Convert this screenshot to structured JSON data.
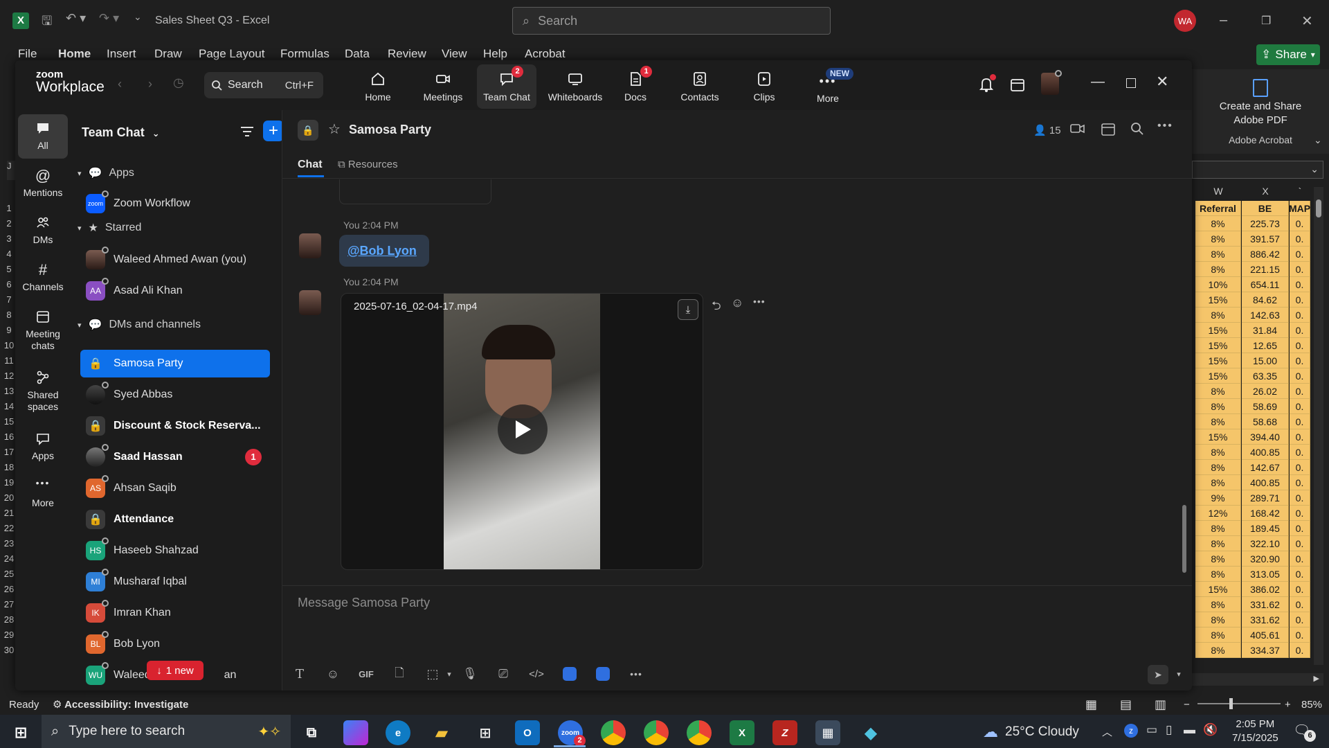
{
  "excel": {
    "title": "Sales Sheet Q3  -  Excel",
    "search_placeholder": "Search",
    "user_initials": "WA",
    "menu": [
      "File",
      "Home",
      "Insert",
      "Draw",
      "Page Layout",
      "Formulas",
      "Data",
      "Review",
      "View",
      "Help",
      "Acrobat"
    ],
    "share_label": "Share",
    "acrobat_btn": "Create and Share Adobe PDF",
    "acrobat_group": "Adobe Acrobat",
    "columns": [
      "W",
      "X"
    ],
    "col_headers": [
      "Referral",
      "BE",
      "MAP"
    ],
    "rows": [
      [
        "8%",
        "225.73",
        "0."
      ],
      [
        "8%",
        "391.57",
        "0."
      ],
      [
        "8%",
        "886.42",
        "0."
      ],
      [
        "8%",
        "221.15",
        "0."
      ],
      [
        "10%",
        "654.11",
        "0."
      ],
      [
        "15%",
        "84.62",
        "0."
      ],
      [
        "8%",
        "142.63",
        "0."
      ],
      [
        "15%",
        "31.84",
        "0."
      ],
      [
        "15%",
        "12.65",
        "0."
      ],
      [
        "15%",
        "15.00",
        "0."
      ],
      [
        "15%",
        "63.35",
        "0."
      ],
      [
        "8%",
        "26.02",
        "0."
      ],
      [
        "8%",
        "58.69",
        "0."
      ],
      [
        "8%",
        "58.68",
        "0."
      ],
      [
        "15%",
        "394.40",
        "0."
      ],
      [
        "8%",
        "400.85",
        "0."
      ],
      [
        "8%",
        "142.67",
        "0."
      ],
      [
        "8%",
        "400.85",
        "0."
      ],
      [
        "9%",
        "289.71",
        "0."
      ],
      [
        "12%",
        "168.42",
        "0."
      ],
      [
        "8%",
        "189.45",
        "0."
      ],
      [
        "8%",
        "322.10",
        "0."
      ],
      [
        "8%",
        "320.90",
        "0."
      ],
      [
        "8%",
        "313.05",
        "0."
      ],
      [
        "15%",
        "386.02",
        "0."
      ],
      [
        "8%",
        "331.62",
        "0."
      ],
      [
        "8%",
        "331.62",
        "0."
      ],
      [
        "8%",
        "405.61",
        "0."
      ],
      [
        "8%",
        "334.37",
        "0."
      ]
    ],
    "row_numbers": [
      "1",
      "2",
      "3",
      "4",
      "5",
      "6",
      "7",
      "8",
      "9",
      "10",
      "11",
      "12",
      "13",
      "14",
      "15",
      "16",
      "17",
      "18",
      "19",
      "20",
      "21",
      "22",
      "23",
      "24",
      "25",
      "26",
      "27",
      "28",
      "29",
      "30"
    ],
    "status_ready": "Ready",
    "status_accessibility": "Accessibility: Investigate",
    "zoom_level": "85%",
    "cell_fill": "#f5c56a"
  },
  "zoom": {
    "brand_line1": "zoom",
    "brand_line2": "Workplace",
    "search_label": "Search",
    "search_shortcut": "Ctrl+F",
    "nav": [
      {
        "label": "Home",
        "badge": ""
      },
      {
        "label": "Meetings",
        "badge": ""
      },
      {
        "label": "Team Chat",
        "badge": "2"
      },
      {
        "label": "Whiteboards",
        "badge": ""
      },
      {
        "label": "Docs",
        "badge": "1"
      },
      {
        "label": "Contacts",
        "badge": ""
      },
      {
        "label": "Clips",
        "badge": ""
      },
      {
        "label": "More",
        "badge": "NEW"
      }
    ],
    "rail": [
      "All",
      "Mentions",
      "DMs",
      "Channels",
      "Meeting chats",
      "Shared spaces",
      "Apps",
      "More"
    ],
    "sidebar": {
      "title": "Team Chat",
      "sections": {
        "apps": "Apps",
        "starred": "Starred",
        "dms": "DMs and channels"
      },
      "apps_items": [
        {
          "label": "Zoom Workflow"
        }
      ],
      "starred_items": [
        {
          "label": "Waleed Ahmed Awan (you)",
          "initials": ""
        },
        {
          "label": "Asad Ali Khan",
          "initials": "AA"
        }
      ],
      "dm_items": [
        {
          "label": "Samosa Party",
          "type": "lock",
          "selected": true
        },
        {
          "label": "Syed Abbas",
          "type": "photo"
        },
        {
          "label": "Discount & Stock Reserva...",
          "type": "lock",
          "bold": true
        },
        {
          "label": "Saad Hassan",
          "type": "photo",
          "bold": true,
          "badge": "1"
        },
        {
          "label": "Ahsan Saqib",
          "type": "initials",
          "initials": "AS",
          "color": "#e0672e"
        },
        {
          "label": "Attendance",
          "type": "lock",
          "bold": true
        },
        {
          "label": "Haseeb Shahzad",
          "type": "initials",
          "initials": "HS",
          "color": "#1aa37a"
        },
        {
          "label": "Musharaf Iqbal",
          "type": "initials",
          "initials": "MI",
          "color": "#2e7fd6"
        },
        {
          "label": "Imran Khan",
          "type": "initials",
          "initials": "IK",
          "color": "#d64b3a"
        },
        {
          "label": "Bob Lyon",
          "type": "initials",
          "initials": "BL",
          "color": "#e0672e"
        },
        {
          "label": "Waleed",
          "type": "initials",
          "initials": "WU",
          "color": "#1aa37a"
        }
      ],
      "new_pill": "1 new",
      "last_item_tail": "an"
    },
    "chat": {
      "title": "Samosa Party",
      "members": "15",
      "tabs": [
        "Chat",
        "Resources"
      ],
      "messages": [
        {
          "meta": "You 2:04 PM",
          "mention": "@Bob Lyon"
        },
        {
          "meta": "You 2:04 PM",
          "file": "2025-07-16_02-04-17.mp4"
        }
      ],
      "composer_placeholder": "Message Samosa Party",
      "tool_gif": "GIF"
    }
  },
  "taskbar": {
    "search_placeholder": "Type here to search",
    "weather": "25°C  Cloudy",
    "time": "2:05 PM",
    "date": "7/15/2025",
    "notif_count": "6",
    "zoom_badge": "2"
  }
}
